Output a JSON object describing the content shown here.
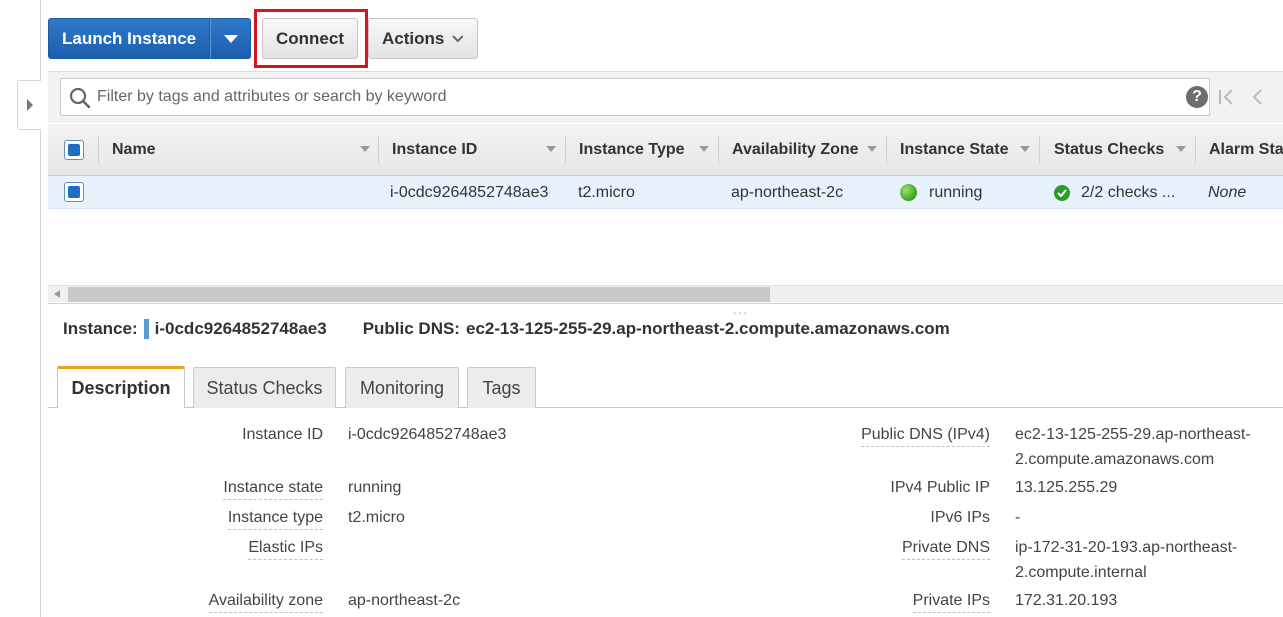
{
  "toolbar": {
    "launch_label": "Launch Instance",
    "connect_label": "Connect",
    "actions_label": "Actions"
  },
  "search": {
    "placeholder": "Filter by tags and attributes or search by keyword",
    "help": "?"
  },
  "table": {
    "headers": [
      "Name",
      "Instance ID",
      "Instance Type",
      "Availability Zone",
      "Instance State",
      "Status Checks",
      "Alarm Sta"
    ],
    "rows": [
      {
        "name": "",
        "instance_id": "i-0cdc9264852748ae3",
        "instance_type": "t2.micro",
        "availability_zone": "ap-northeast-2c",
        "instance_state": "running",
        "status_checks": "2/2 checks ...",
        "alarm_status": "None"
      }
    ]
  },
  "instance_header": {
    "instance_label": "Instance:",
    "instance_id": "i-0cdc9264852748ae3",
    "dns_label": "Public DNS:",
    "dns_value": "ec2-13-125-255-29.ap-northeast-2.compute.amazonaws.com"
  },
  "tabs": [
    "Description",
    "Status Checks",
    "Monitoring",
    "Tags"
  ],
  "description": {
    "left": [
      {
        "label": "Instance ID",
        "value": "i-0cdc9264852748ae3"
      },
      {
        "label": "Instance state",
        "value": "running"
      },
      {
        "label": "Instance type",
        "value": "t2.micro"
      },
      {
        "label": "Elastic IPs",
        "value": ""
      },
      {
        "label": "Availability zone",
        "value": "ap-northeast-2c"
      }
    ],
    "right": [
      {
        "label": "Public DNS (IPv4)",
        "value_line1": "ec2-13-125-255-29.ap-northeast-",
        "value_line2": "2.compute.amazonaws.com"
      },
      {
        "label": "IPv4 Public IP",
        "value": "13.125.255.29"
      },
      {
        "label": "IPv6 IPs",
        "value": "-"
      },
      {
        "label": "Private DNS",
        "value_line1": "ip-172-31-20-193.ap-northeast-",
        "value_line2": "2.compute.internal"
      },
      {
        "label": "Private IPs",
        "value": "172.31.20.193"
      }
    ]
  },
  "colors": {
    "primary_button": "#1f6dc5",
    "highlight_box": "#d4141f",
    "active_tab_accent": "#f0a01e",
    "running_status": "#38a31c",
    "selected_row": "#e8f2fd"
  }
}
